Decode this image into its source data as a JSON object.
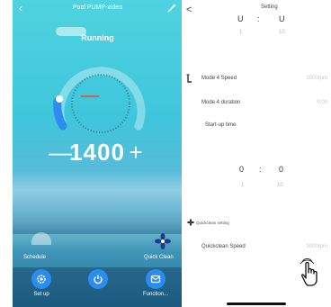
{
  "left": {
    "title": "Pool PUMP-video",
    "status": "Running",
    "speed": "1400",
    "minus": "—",
    "plus": "+",
    "schedule_label": "Schedule",
    "quick_clean_label": "Quick Clean",
    "bottom": [
      {
        "label": "Set up",
        "icon": "gear-icon"
      },
      {
        "label": "",
        "icon": "power-icon"
      },
      {
        "label": "Function...",
        "icon": "function-icon"
      }
    ],
    "icons": {
      "back": "back-arrow-icon",
      "edit": "edit-icon",
      "quick_clean": "fan-icon"
    }
  },
  "right": {
    "back": "<",
    "title": "Setting",
    "time_top": {
      "h": "U",
      "sep": ":",
      "m": "U",
      "sub_h": "1",
      "sub_m": "10"
    },
    "mode4_speed_label": "Mode 4 Speed",
    "mode4_speed_value": "1000rpm",
    "mode4_duration_label": "Mode 4 duration",
    "mode4_duration_value": "0:00",
    "startup_label": "Start-up time",
    "time_bottom": {
      "h": "0",
      "sep": ":",
      "m": "0",
      "sub_h": "1",
      "sub_m": "10"
    },
    "quickclean_setting_label": "Quickclean setting",
    "quickclean_speed_label": "Quickclean Speed",
    "quickclean_speed_value": "3000rpm",
    "icons": {
      "mode": "timer-icon",
      "quickclean": "fan-icon",
      "hand": "hand-pointer-icon"
    }
  },
  "colors": {
    "accent": "#2d8cf0",
    "needle": "#ff3b30",
    "teal": "#4fd3df"
  }
}
